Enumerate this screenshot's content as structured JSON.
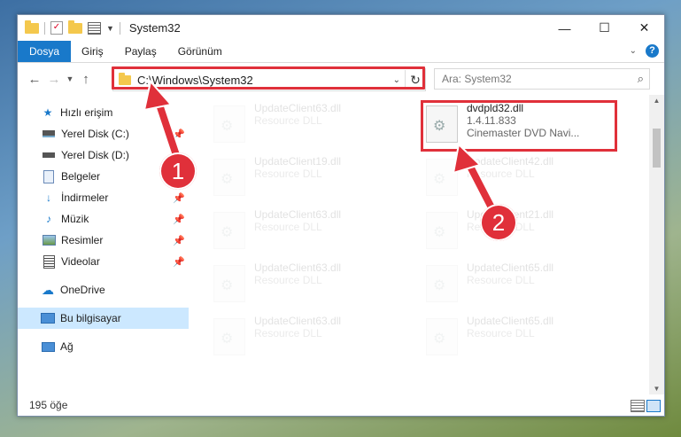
{
  "window": {
    "title": "System32",
    "controls": {
      "minimize": "—",
      "maximize": "☐",
      "close": "✕"
    }
  },
  "ribbon": {
    "tabs": [
      {
        "label": "Dosya",
        "active": true
      },
      {
        "label": "Giriş"
      },
      {
        "label": "Paylaş"
      },
      {
        "label": "Görünüm"
      }
    ]
  },
  "address": {
    "path": "C:\\Windows\\System32",
    "search_placeholder": "Ara: System32"
  },
  "nav": {
    "items": [
      {
        "label": "Hızlı erişim",
        "icon": "star-icon"
      },
      {
        "label": "Yerel Disk (C:)",
        "icon": "drive-icon",
        "pinned": true
      },
      {
        "label": "Yerel Disk (D:)",
        "icon": "drive-icon"
      },
      {
        "label": "Belgeler",
        "icon": "documents-icon"
      },
      {
        "label": "İndirmeler",
        "icon": "download-icon",
        "pinned": true
      },
      {
        "label": "Müzik",
        "icon": "music-icon",
        "pinned": true
      },
      {
        "label": "Resimler",
        "icon": "pictures-icon",
        "pinned": true
      },
      {
        "label": "Videolar",
        "icon": "videos-icon",
        "pinned": true
      },
      {
        "label": "OneDrive",
        "icon": "cloud-icon"
      },
      {
        "label": "Bu bilgisayar",
        "icon": "computer-icon",
        "selected": true
      },
      {
        "label": "Ağ",
        "icon": "network-icon"
      }
    ]
  },
  "files": {
    "highlighted": {
      "name": "dvdpld32.dll",
      "version": "1.4.11.833",
      "description": "Cinemaster DVD Navi..."
    },
    "faded": [
      {
        "name": "UpdateClient63.dll",
        "sub": "Resource DLL"
      },
      {
        "name": "UpdateClient19.dll",
        "sub": "Resource DLL"
      },
      {
        "name": "UpdateClient42.dll",
        "sub": "Resource DLL"
      },
      {
        "name": "UpdateClient63.dll",
        "sub": "Resource DLL"
      },
      {
        "name": "UpdateClient21.dll",
        "sub": "Resource DLL"
      },
      {
        "name": "UpdateClient63.dll",
        "sub": "Resource DLL"
      },
      {
        "name": "UpdateClient65.dll",
        "sub": "Resource DLL"
      },
      {
        "name": "UpdateClient63.dll",
        "sub": "Resource DLL"
      },
      {
        "name": "UpdateClient65.dll",
        "sub": "Resource DLL"
      }
    ]
  },
  "status": {
    "count": "195 öğe"
  },
  "annotations": {
    "step1": "1",
    "step2": "2"
  },
  "colors": {
    "accent": "#1979ca",
    "highlight": "#e0303a",
    "selected": "#cce8ff"
  }
}
